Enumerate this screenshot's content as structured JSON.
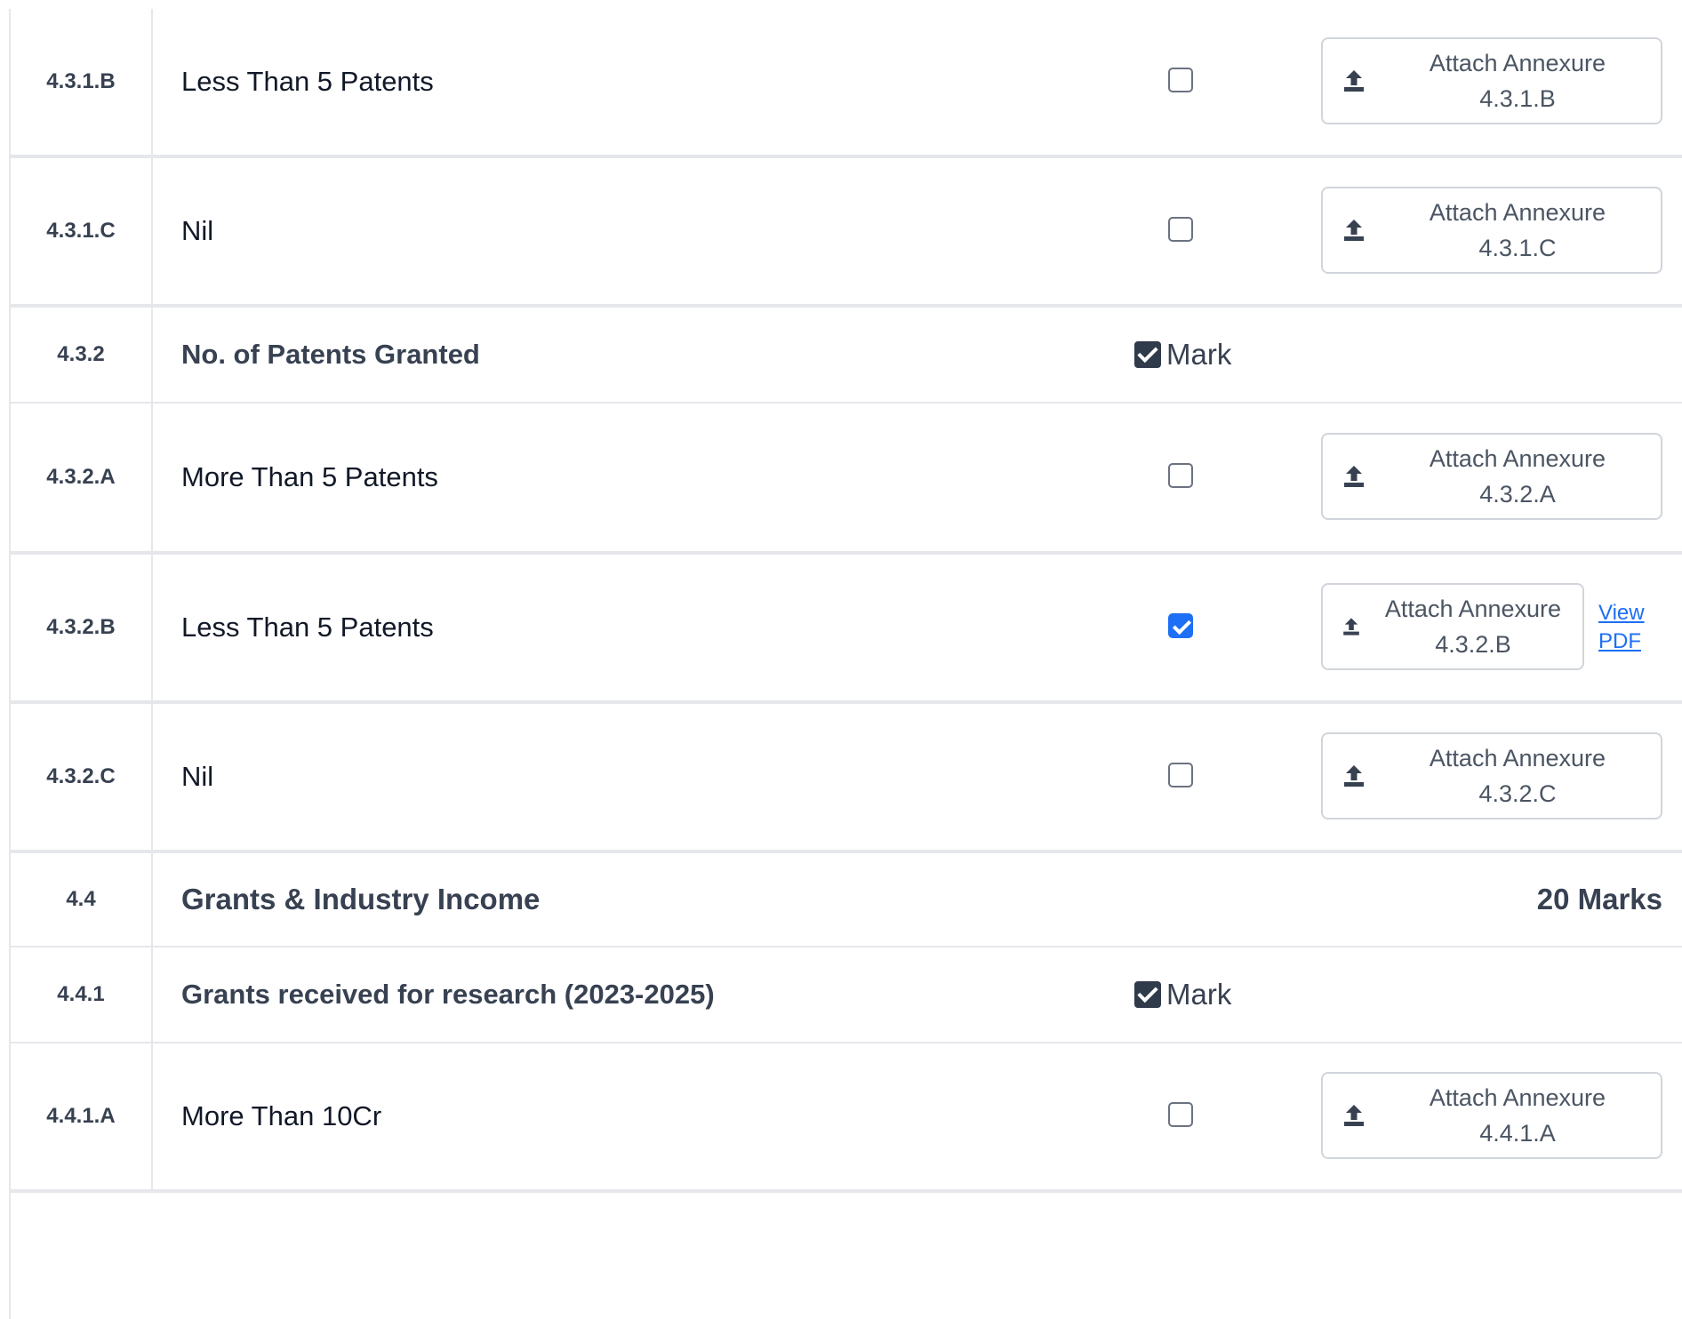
{
  "rows": [
    {
      "code": "4.3.1.B",
      "title": "Less Than 5 Patents",
      "checked": false,
      "attach_line1": "Attach Annexure",
      "attach_line2": "4.3.1.B"
    },
    {
      "code": "4.3.1.C",
      "title": "Nil",
      "checked": false,
      "attach_line1": "Attach Annexure",
      "attach_line2": "4.3.1.C"
    },
    {
      "code": "4.3.2",
      "title": "No. of Patents Granted",
      "mark_label": "Mark"
    },
    {
      "code": "4.3.2.A",
      "title": "More Than 5 Patents",
      "checked": false,
      "attach_line1": "Attach Annexure",
      "attach_line2": "4.3.2.A"
    },
    {
      "code": "4.3.2.B",
      "title": "Less Than 5 Patents",
      "checked": true,
      "attach_line1": "Attach Annexure",
      "attach_line2": "4.3.2.B",
      "view_link": "View PDF"
    },
    {
      "code": "4.3.2.C",
      "title": "Nil",
      "checked": false,
      "attach_line1": "Attach Annexure",
      "attach_line2": "4.3.2.C"
    },
    {
      "code": "4.4",
      "title": "Grants & Industry Income",
      "marks": "20 Marks"
    },
    {
      "code": "4.4.1",
      "title": "Grants received for research (2023-2025)",
      "mark_label": "Mark"
    },
    {
      "code": "4.4.1.A",
      "title": "More Than 10Cr",
      "checked": false,
      "attach_line1": "Attach Annexure",
      "attach_line2": "4.4.1.A"
    }
  ],
  "colors": {
    "accent": "#1d6ff5",
    "border": "#e5e7eb",
    "text": "#374151"
  },
  "icons": {
    "upload": "upload-icon"
  }
}
